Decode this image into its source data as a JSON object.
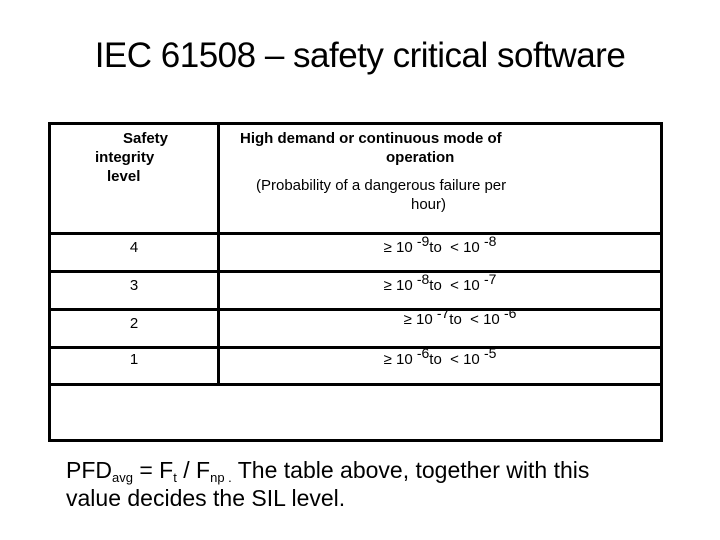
{
  "slide": {
    "title": "IEC 61508 – safety critical software"
  },
  "table": {
    "header_left": [
      "Safety",
      "integrity",
      "level"
    ],
    "header_right_bold": [
      "High demand or continuous mode of",
      "operation"
    ],
    "header_right_note": [
      "(Probability of a dangerous failure per",
      "hour)"
    ],
    "rows": [
      {
        "sil": "4",
        "ge": "≥",
        "base1": "10",
        "exp1": "-9",
        "to": "to",
        "lt": "<",
        "base2": "10",
        "exp2": "-8"
      },
      {
        "sil": "3",
        "ge": "≥",
        "base1": "10",
        "exp1": "-8",
        "to": "to",
        "lt": "<",
        "base2": "10",
        "exp2": "-7"
      },
      {
        "sil": "2",
        "ge": "≥",
        "base1": "10",
        "exp1": "-7",
        "to": "to",
        "lt": "<",
        "base2": "10",
        "exp2": "-6"
      },
      {
        "sil": "1",
        "ge": "≥",
        "base1": "10",
        "exp1": "-6",
        "to": "to",
        "lt": "<",
        "base2": "10",
        "exp2": "-5"
      }
    ]
  },
  "caption": {
    "pfd": "PFD",
    "pfd_sub": "avg",
    "eq": " = F",
    "ft_sub": "t",
    "div": " / F",
    "fnp_sub": "np .",
    "text1": " The table above, together with this",
    "text2": "value decides the SIL level."
  }
}
